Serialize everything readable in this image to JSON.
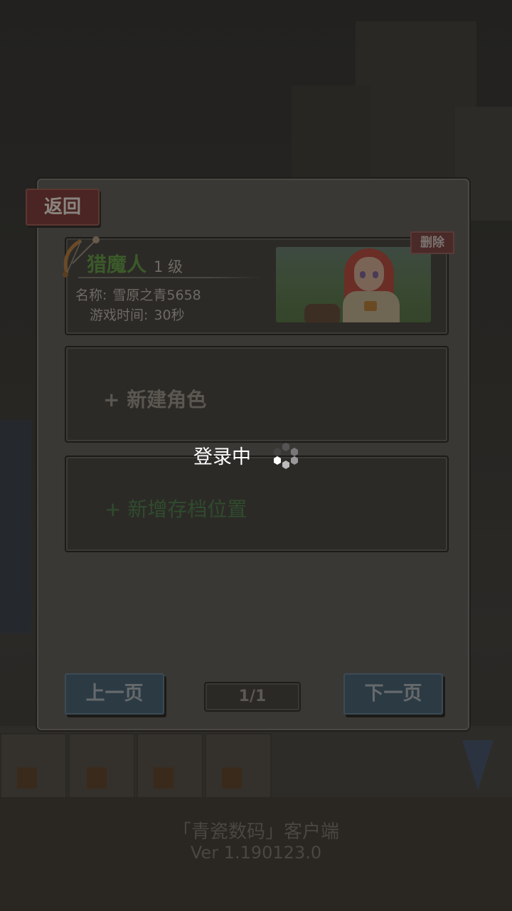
{
  "panel": {
    "back_label": "返回",
    "delete_label": "删除"
  },
  "save_slots": [
    {
      "job": "猎魔人",
      "level": "1 级",
      "name_label": "名称:",
      "name": "雪原之青5658",
      "time_label": "游戏时间:",
      "time": "30秒"
    }
  ],
  "new_character_label": "+ 新建角色",
  "new_slot_label": "+ 新增存档位置",
  "pagination": {
    "prev_label": "上一页",
    "next_label": "下一页",
    "page_indicator": "1/1"
  },
  "loading": {
    "text": "登录中"
  },
  "footer": {
    "title": "「青瓷数码」客户端",
    "version": "Ver 1.190123.0"
  },
  "colors": {
    "job_green": "#3b5a2a",
    "overlay_text": "#ffffff"
  }
}
